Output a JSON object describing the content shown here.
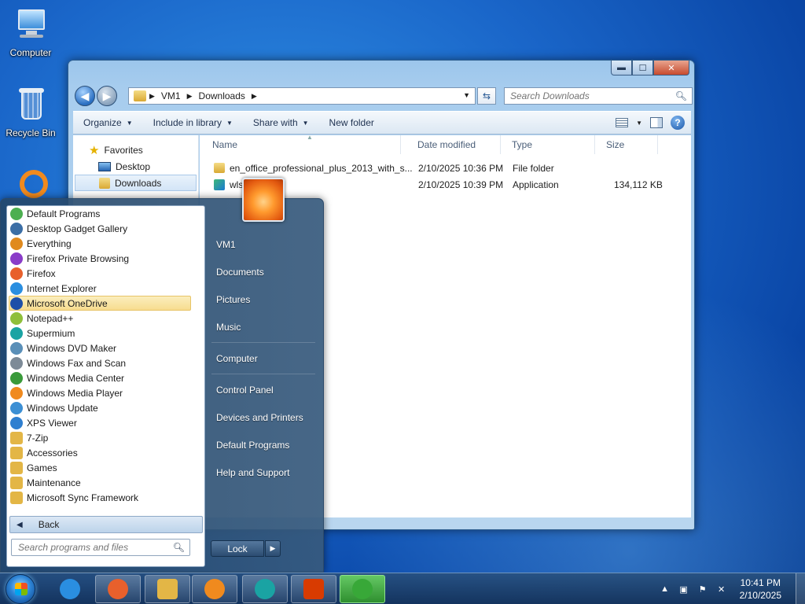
{
  "desktop": {
    "icons": [
      {
        "label": "Computer"
      },
      {
        "label": "Recycle Bin"
      }
    ]
  },
  "explorer": {
    "breadcrumb": [
      "VM1",
      "Downloads"
    ],
    "search_placeholder": "Search Downloads",
    "toolbar": {
      "organize": "Organize",
      "include_in_library": "Include in library",
      "share_with": "Share with",
      "new_folder": "New folder"
    },
    "nav": {
      "favorites": "Favorites",
      "desktop": "Desktop",
      "downloads": "Downloads"
    },
    "columns": {
      "name": "Name",
      "date_modified": "Date modified",
      "type": "Type",
      "size": "Size"
    },
    "files": [
      {
        "name": "en_office_professional_plus_2013_with_s...",
        "date": "2/10/2025 10:36 PM",
        "type": "File folder",
        "size": ""
      },
      {
        "name": "wls          english",
        "date": "2/10/2025 10:39 PM",
        "type": "Application",
        "size": "134,112 KB"
      }
    ]
  },
  "start_menu": {
    "programs": [
      {
        "label": "Default Programs",
        "icon": "default-programs-icon",
        "color": "#4caf50"
      },
      {
        "label": "Desktop Gadget Gallery",
        "icon": "gadget-icon",
        "color": "#3b6ea5"
      },
      {
        "label": "Everything",
        "icon": "magnifier-icon",
        "color": "#e08a1e"
      },
      {
        "label": "Firefox Private Browsing",
        "icon": "firefox-private-icon",
        "color": "#8a3cc8"
      },
      {
        "label": "Firefox",
        "icon": "firefox-icon",
        "color": "#e8602c"
      },
      {
        "label": "Internet Explorer",
        "icon": "ie-icon",
        "color": "#2a8ee0"
      },
      {
        "label": "Microsoft OneDrive",
        "icon": "onedrive-icon",
        "color": "#1e4fa8"
      },
      {
        "label": "Notepad++",
        "icon": "notepad-plus-icon",
        "color": "#8fbf3a"
      },
      {
        "label": "Supermium",
        "icon": "supermium-icon",
        "color": "#1aa3a3"
      },
      {
        "label": "Windows DVD Maker",
        "icon": "dvd-maker-icon",
        "color": "#5a8fb8"
      },
      {
        "label": "Windows Fax and Scan",
        "icon": "fax-icon",
        "color": "#7d8a97"
      },
      {
        "label": "Windows Media Center",
        "icon": "media-center-icon",
        "color": "#3a9a3a"
      },
      {
        "label": "Windows Media Player",
        "icon": "media-player-icon",
        "color": "#f08a1e"
      },
      {
        "label": "Windows Update",
        "icon": "windows-update-icon",
        "color": "#3c8fd4"
      },
      {
        "label": "XPS Viewer",
        "icon": "xps-icon",
        "color": "#2f7fd0"
      },
      {
        "label": "7-Zip",
        "icon": "folder-icon",
        "color": "#e3b646"
      },
      {
        "label": "Accessories",
        "icon": "folder-icon",
        "color": "#e3b646"
      },
      {
        "label": "Games",
        "icon": "folder-icon",
        "color": "#e3b646"
      },
      {
        "label": "Maintenance",
        "icon": "folder-icon",
        "color": "#e3b646"
      },
      {
        "label": "Microsoft Sync Framework",
        "icon": "folder-icon",
        "color": "#e3b646"
      }
    ],
    "highlighted_index": 6,
    "back_label": "Back",
    "search_placeholder": "Search programs and files",
    "right_links": [
      "VM1",
      "Documents",
      "Pictures",
      "Music",
      "Computer",
      "Control Panel",
      "Devices and Printers",
      "Default Programs",
      "Help and Support"
    ],
    "lock_label": "Lock"
  },
  "taskbar": {
    "apps": [
      {
        "name": "internet-explorer",
        "icon": "ie-icon",
        "color": "#2a8ee0"
      },
      {
        "name": "firefox",
        "icon": "firefox-icon",
        "color": "#e8602c"
      },
      {
        "name": "file-explorer",
        "icon": "folder-icon",
        "color": "#e3b646"
      },
      {
        "name": "media-player",
        "icon": "media-player-icon",
        "color": "#f08a1e"
      },
      {
        "name": "supermium",
        "icon": "supermium-icon",
        "color": "#1aa3a3"
      },
      {
        "name": "office",
        "icon": "office-icon",
        "color": "#d83b01"
      },
      {
        "name": "installer",
        "icon": "installer-icon",
        "color": "#38a838"
      }
    ],
    "time": "10:41 PM",
    "date": "2/10/2025"
  }
}
